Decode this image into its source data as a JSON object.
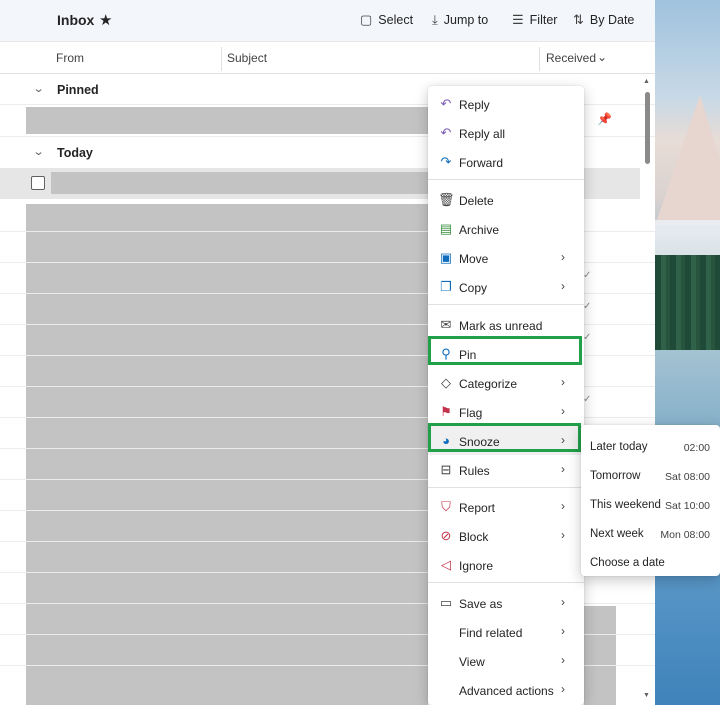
{
  "toolbar": {
    "title": "Inbox",
    "select_label": "Select",
    "jump_label": "Jump to",
    "filter_label": "Filter",
    "sort_label": "By Date"
  },
  "columns": {
    "from": "From",
    "subject": "Subject",
    "received": "Received"
  },
  "groups": {
    "pinned": "Pinned",
    "today": "Today"
  },
  "menu": {
    "reply": "Reply",
    "reply_all": "Reply all",
    "forward": "Forward",
    "delete": "Delete",
    "archive": "Archive",
    "move": "Move",
    "copy": "Copy",
    "mark_unread": "Mark as unread",
    "pin": "Pin",
    "categorize": "Categorize",
    "flag": "Flag",
    "snooze": "Snooze",
    "rules": "Rules",
    "report": "Report",
    "block": "Block",
    "ignore": "Ignore",
    "save_as": "Save as",
    "find_related": "Find related",
    "view": "View",
    "advanced_actions": "Advanced actions"
  },
  "snooze": {
    "later_today": "Later today",
    "later_today_time": "02:00",
    "tomorrow": "Tomorrow",
    "tomorrow_time": "Sat 08:00",
    "this_weekend": "This weekend",
    "this_weekend_time": "Sat 10:00",
    "next_week": "Next week",
    "next_week_time": "Mon 08:00",
    "choose_date": "Choose a date"
  },
  "colors": {
    "highlight": "#21a04a",
    "accent": "#0f6cbd",
    "flag": "#c4314b"
  }
}
